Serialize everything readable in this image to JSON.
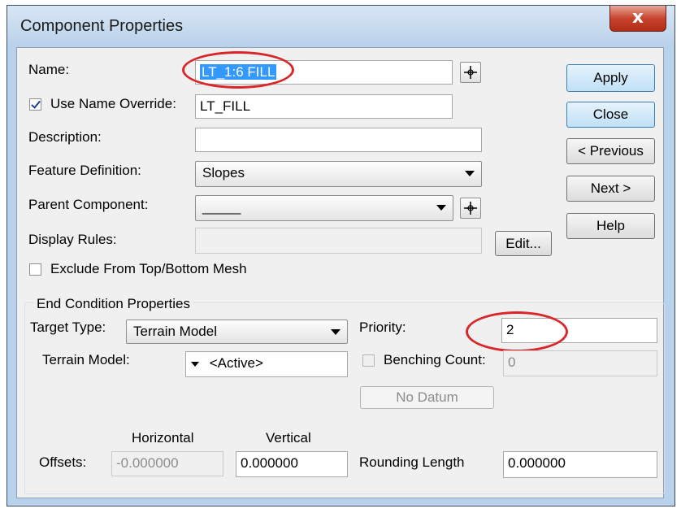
{
  "window": {
    "title": "Component Properties",
    "close_glyph": "x"
  },
  "fields": {
    "name_label": "Name:",
    "name_value": "LT_1:6 FILL",
    "use_name_override_label": "Use Name Override:",
    "use_name_override_checked": true,
    "name_override_value": "LT_FILL",
    "description_label": "Description:",
    "description_value": "",
    "feature_definition_label": "Feature Definition:",
    "feature_definition_value": "Slopes",
    "parent_component_label": "Parent Component:",
    "parent_component_value": "_____",
    "display_rules_label": "Display Rules:",
    "display_rules_value": "",
    "exclude_mesh_label": "Exclude From Top/Bottom Mesh",
    "exclude_mesh_checked": false
  },
  "buttons": {
    "apply": "Apply",
    "close": "Close",
    "previous": "< Previous",
    "next": "Next >",
    "help": "Help",
    "edit": "Edit...",
    "no_datum": "No Datum"
  },
  "end_condition": {
    "group_title": "End Condition Properties",
    "target_type_label": "Target Type:",
    "target_type_value": "Terrain Model",
    "priority_label": "Priority:",
    "priority_value": "2",
    "terrain_model_label": "Terrain Model:",
    "terrain_model_value": "<Active>",
    "benching_count_label": "Benching Count:",
    "benching_count_value": "0",
    "horizontal_label": "Horizontal",
    "vertical_label": "Vertical",
    "offsets_label": "Offsets:",
    "horizontal_value": "-0.000000",
    "vertical_value": "0.000000",
    "rounding_length_label": "Rounding Length",
    "rounding_length_value": "0.000000"
  },
  "annotation_color": "#d8262b",
  "icons": [
    "close-icon",
    "target-pick-icon",
    "dropdown-arrow-icon",
    "checkmark-icon"
  ]
}
